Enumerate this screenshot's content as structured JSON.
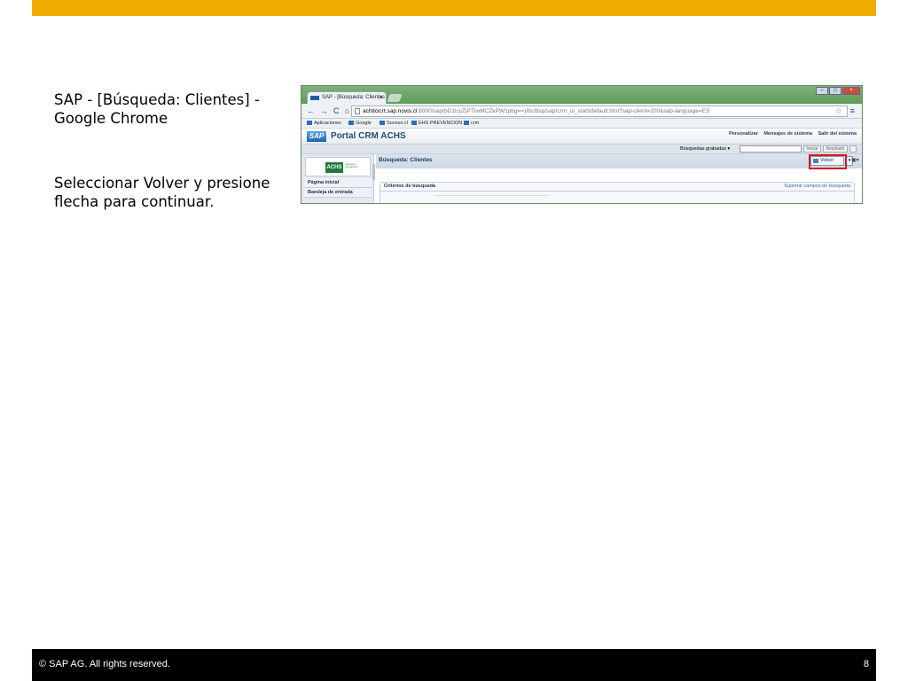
{
  "slide": {
    "instruction_title": "SAP - [Búsqueda: Clientes] - Google Chrome",
    "instruction_body": "Seleccionar Volver y presione flecha para continuar.",
    "footer_copyright": "©  SAP AG. All rights reserved.",
    "page_number": "8",
    "accent_color": "#f0ab00"
  },
  "browser": {
    "tab_title": "SAP - [Búsqueda: Clientes",
    "tab_close": "×",
    "url_host": "achtlcicrt.sap.novis.cl",
    "url_rest": ":8000/sap(bD1lcyZjPTIwMCZkPW1pbg==)/bc/bsp/sap/crm_ui_start/default.htm?sap-client=200&sap-language=ES",
    "bookmarks": [
      "Aplicaciones",
      "Google",
      "Suceso.cl",
      "EHS PREVENCION",
      "crm"
    ]
  },
  "sap": {
    "logo_text": "SAP",
    "portal_title": "Portal CRM ACHS",
    "top_links": [
      "Personalizar",
      "Mensajes de sistema",
      "Salir del sistema"
    ],
    "saved_searches_label": "Búsquedas grabadas ▾",
    "iniciar_label": "Iniciar",
    "ampliado_label": "Ampliado",
    "achs_logo": "ACHS",
    "achs_sub": "mas que prevención",
    "nav_items": [
      "Página inicial",
      "Bandeja de entrada"
    ],
    "page_title": "Búsqueda: Clientes",
    "volver_label": "Volver",
    "criteria_title": "Criterios de búsqueda",
    "criteria_link": "Suprimir campos de búsqueda"
  }
}
